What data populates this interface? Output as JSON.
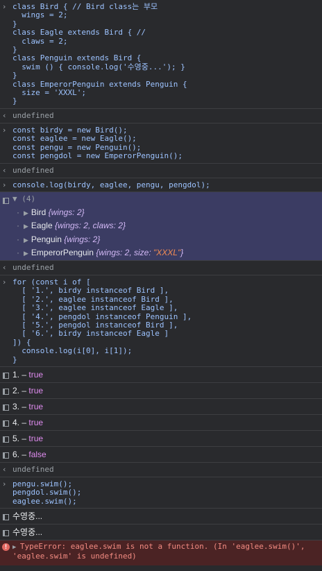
{
  "entries": [
    {
      "kind": "input",
      "code": "class Bird { // Bird class는 부모\n  wings = 2;\n}\nclass Eagle extends Bird { //\n  claws = 2;\n}\nclass Penguin extends Bird {\n  swim () { console.log('수영중...'); }\n}\nclass EmperorPenguin extends Penguin {\n  size = 'XXXL';\n}"
    },
    {
      "kind": "result",
      "text": "undefined"
    },
    {
      "kind": "input",
      "code": "const birdy = new Bird();\nconst eaglee = new Eagle();\nconst pengu = new Penguin();\nconst pengdol = new EmperorPenguin();"
    },
    {
      "kind": "result",
      "text": "undefined"
    },
    {
      "kind": "input",
      "code": "console.log(birdy, eaglee, pengu, pengdol);"
    },
    {
      "kind": "group",
      "count": "(4)",
      "items": [
        {
          "name": "Bird",
          "props": "{wings: 2}"
        },
        {
          "name": "Eagle",
          "props": "{wings: 2, claws: 2}"
        },
        {
          "name": "Penguin",
          "props": "{wings: 2}"
        },
        {
          "name": "EmperorPenguin",
          "props_pre": "{wings: 2, size: ",
          "props_str": "\"XXXL\"",
          "props_post": "}"
        }
      ]
    },
    {
      "kind": "result",
      "text": "undefined"
    },
    {
      "kind": "input",
      "code": "for (const i of [\n  [ '1.', birdy instanceof Bird ],\n  [ '2.', eaglee instanceof Bird ],\n  [ '3.', eaglee instanceof Eagle ],\n  [ '4.', pengdol instanceof Penguin ],\n  [ '5.', pengdol instanceof Bird ],\n  [ '6.', birdy instanceof Eagle ]\n]) {\n  console.log(i[0], i[1]);\n}"
    },
    {
      "kind": "log",
      "num": "1.",
      "sep": " – ",
      "val": "true"
    },
    {
      "kind": "log",
      "num": "2.",
      "sep": " – ",
      "val": "true"
    },
    {
      "kind": "log",
      "num": "3.",
      "sep": " – ",
      "val": "true"
    },
    {
      "kind": "log",
      "num": "4.",
      "sep": " – ",
      "val": "true"
    },
    {
      "kind": "log",
      "num": "5.",
      "sep": " – ",
      "val": "true"
    },
    {
      "kind": "log",
      "num": "6.",
      "sep": " – ",
      "val": "false"
    },
    {
      "kind": "result",
      "text": "undefined"
    },
    {
      "kind": "input",
      "code": "pengu.swim();\npengdol.swim();\neaglee.swim();"
    },
    {
      "kind": "plainlog",
      "text": "수영중..."
    },
    {
      "kind": "plainlog",
      "text": "수영중..."
    },
    {
      "kind": "error",
      "text": "TypeError: eaglee.swim is not a function. (In 'eaglee.swim()',\n'eaglee.swim' is undefined)"
    }
  ],
  "icons": {
    "prompt": "›",
    "return": "‹",
    "log": "log-icon",
    "expand": "▼",
    "collapsed": "▶",
    "error": "!"
  }
}
